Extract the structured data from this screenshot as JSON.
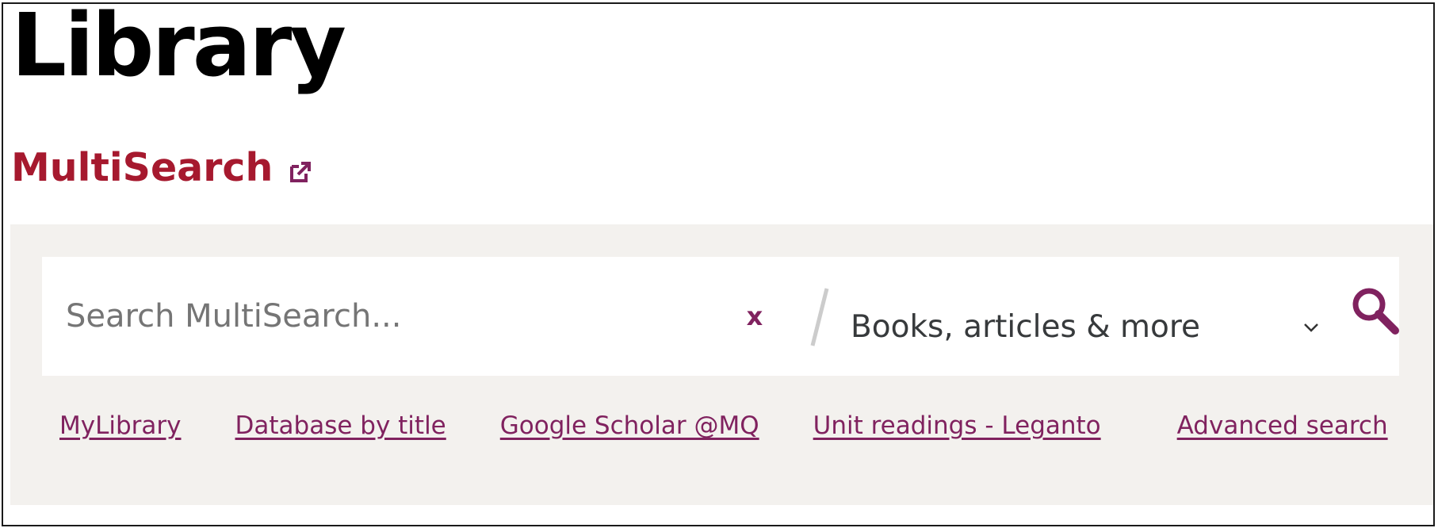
{
  "page": {
    "title": "Library"
  },
  "multisearch": {
    "heading": "MultiSearch",
    "external_icon": "external-link-icon",
    "search": {
      "placeholder": "Search MultiSearch...",
      "value": "",
      "clear_label": "x",
      "scope_selected": "Books, articles & more",
      "scope_icon": "chevron-down-icon",
      "submit_icon": "magnifier-icon"
    },
    "links": [
      "MyLibrary",
      "Database by title",
      "Google Scholar @MQ",
      "Unit readings - Leganto",
      "Advanced search"
    ]
  },
  "colors": {
    "heading_red": "#a6192e",
    "accent_plum": "#80225f",
    "panel_bg": "#f3f1ee",
    "divider_gray": "#cccccc"
  }
}
